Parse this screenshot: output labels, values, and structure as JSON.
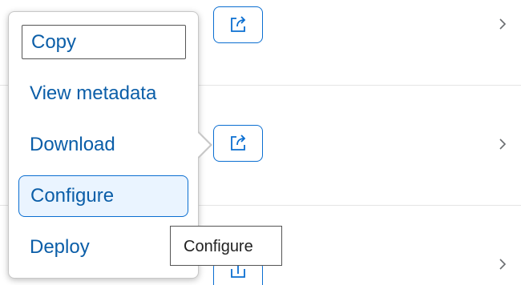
{
  "menu": {
    "items": [
      {
        "label": "Copy"
      },
      {
        "label": "View metadata"
      },
      {
        "label": "Download"
      },
      {
        "label": "Configure"
      },
      {
        "label": "Deploy"
      }
    ]
  },
  "tooltip": {
    "text": "Configure"
  },
  "icons": {
    "row_action": "share-icon",
    "row_navigation": "chevron-right-icon"
  },
  "colors": {
    "accent": "#0a6ed1",
    "link_text": "#0b5ea8",
    "active_item_bg": "#eaf4ff"
  }
}
